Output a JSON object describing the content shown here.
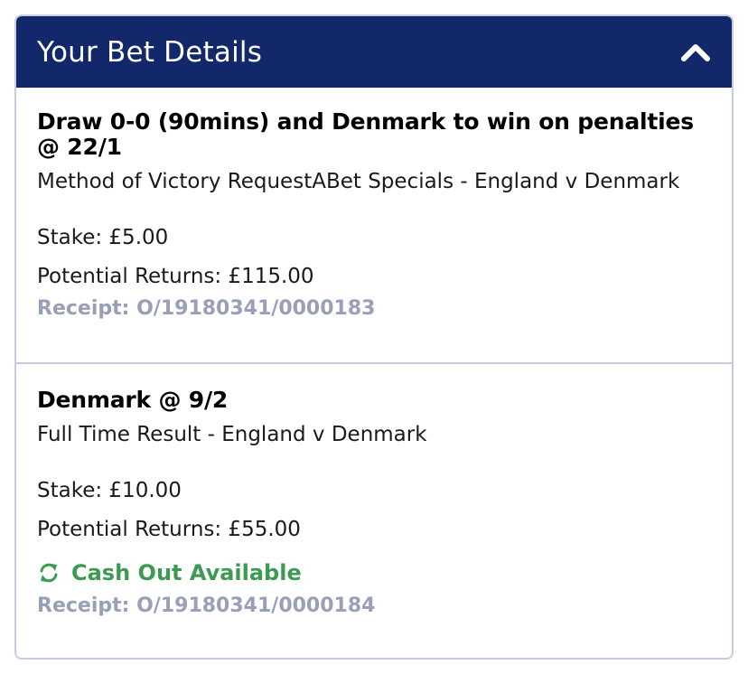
{
  "header": {
    "title": "Your Bet Details",
    "toggle_icon": "chevron-up-icon"
  },
  "bets": [
    {
      "selection": "Draw 0-0 (90mins) and Denmark to win on penalties @ 22/1",
      "market": "Method of Victory RequestABet Specials - England v Denmark",
      "stake": "Stake: £5.00",
      "potential_returns": "Potential Returns: £115.00",
      "receipt": "Receipt: O/19180341/0000183"
    },
    {
      "selection": "Denmark @ 9/2",
      "market": "Full Time Result - England v Denmark",
      "stake": "Stake: £10.00",
      "potential_returns": "Potential Returns: £55.00",
      "cash_out": "Cash Out Available",
      "cash_out_icon": "refresh-icon",
      "receipt": "Receipt: O/19180341/0000184"
    }
  ],
  "colors": {
    "header_bg": "#12286b",
    "receipt_text": "#97a0b6",
    "cash_out_green": "#3c9a52",
    "border": "#c9cbe0"
  }
}
